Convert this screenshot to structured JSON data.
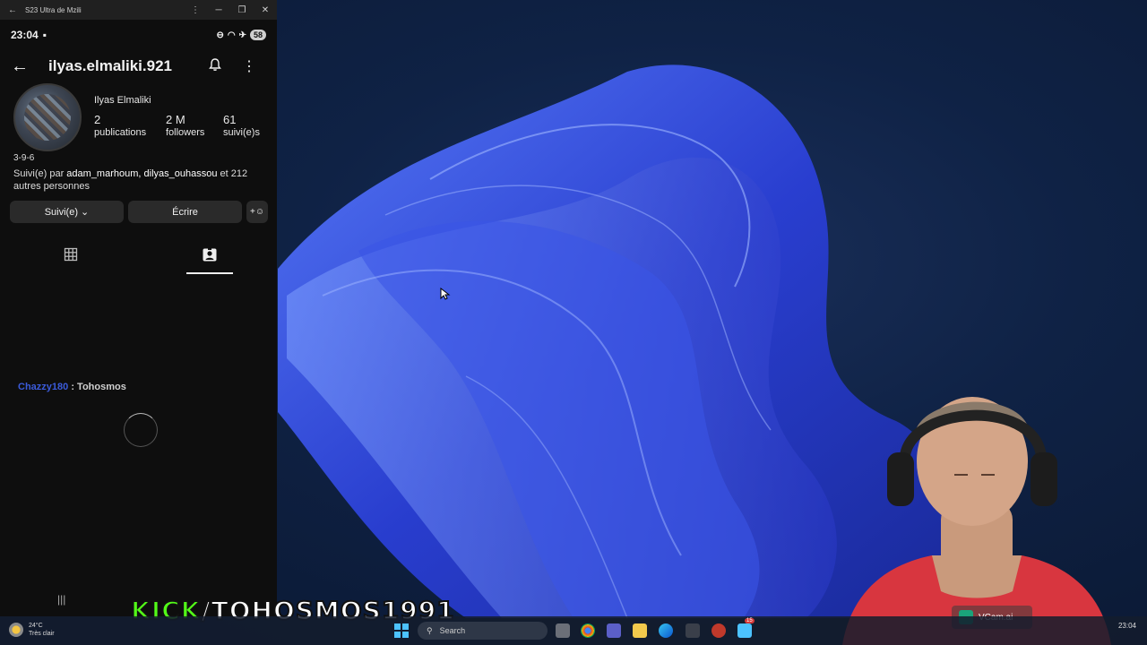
{
  "window": {
    "title": "S23 Ultra de Mzili",
    "back_glyph": "←",
    "menu_glyph": "⋮",
    "minimize_glyph": "─",
    "restore_glyph": "❐",
    "close_glyph": "✕"
  },
  "status_bar": {
    "time": "23:04",
    "battery": "58"
  },
  "profile": {
    "username": "ilyas.elmaliki.921",
    "display_name": "Ilyas Elmaliki",
    "stats": [
      {
        "value": "2",
        "label": "publications"
      },
      {
        "value": "2 M",
        "label": "followers"
      },
      {
        "value": "61",
        "label": "suivi(e)s"
      }
    ],
    "bio": "3-9-6",
    "followed_by_prefix": "Suivi(e) par ",
    "followed_by_names": "adam_marhoum, dilyas_ouhassou",
    "followed_by_suffix": " et 212 autres personnes",
    "buttons": {
      "follow": "Suivi(e) ⌄",
      "write": "Écrire",
      "add": "+"
    }
  },
  "chat": {
    "user": "Chazzy180",
    "message": " : Tohosmos"
  },
  "nav": {
    "recents": "|||"
  },
  "banner": {
    "kick": "KICK",
    "rest": "/TOHOSMOS1991"
  },
  "vcam": {
    "label": "VCam.ai"
  },
  "taskbar": {
    "temperature": "24°C",
    "weather": "Très clair",
    "search_placeholder": "Search",
    "notification_count": "15"
  },
  "colors": {
    "accent": "#4cc2ff",
    "kick_green": "#53fc18",
    "chat_user": "#3b5bdb"
  }
}
